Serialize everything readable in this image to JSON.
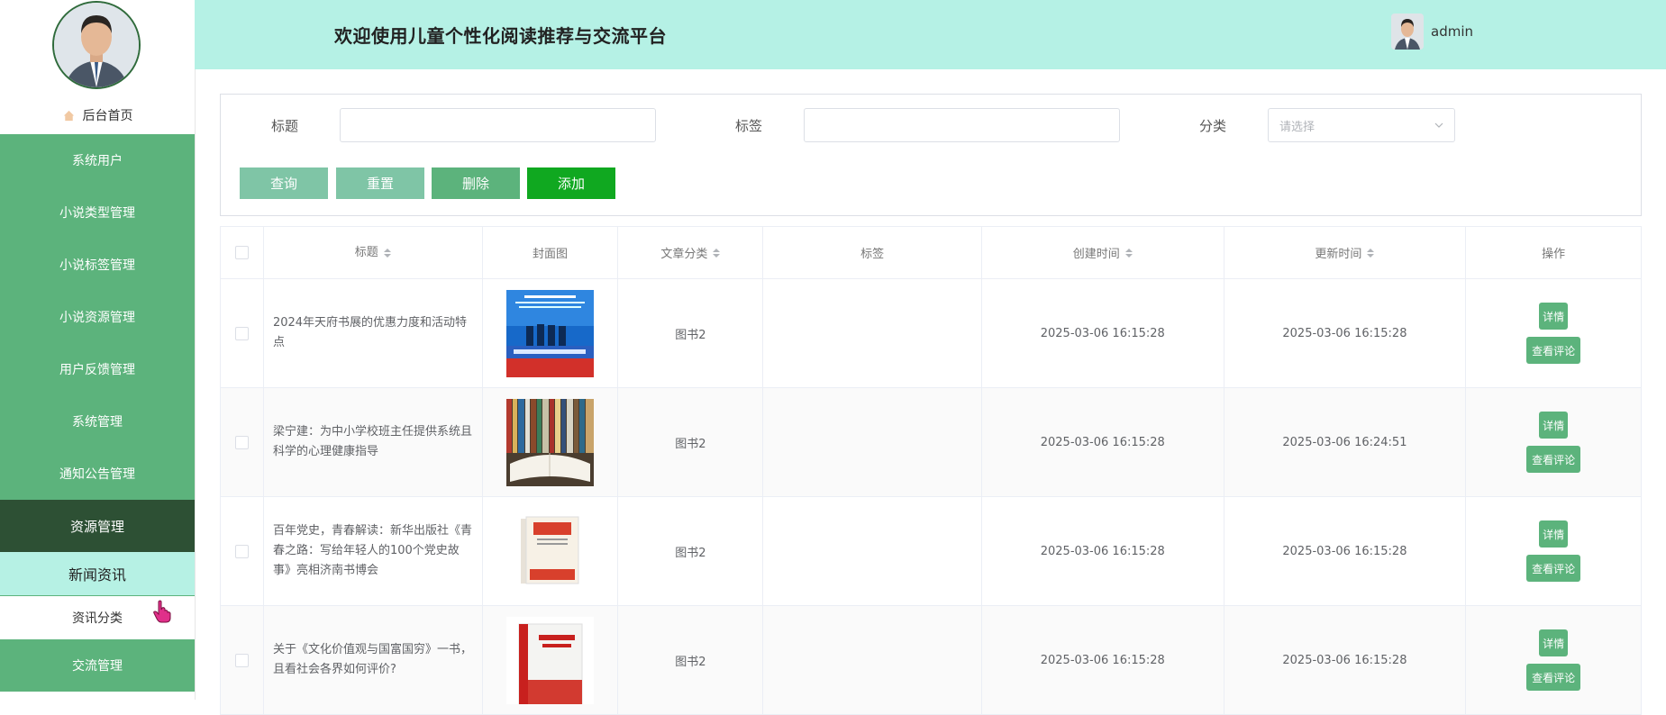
{
  "header": {
    "title": "欢迎使用儿童个性化阅读推荐与交流平台",
    "username": "admin"
  },
  "sidebar": {
    "home_label": "后台首页",
    "items": [
      {
        "label": "系统用户"
      },
      {
        "label": "小说类型管理"
      },
      {
        "label": "小说标签管理"
      },
      {
        "label": "小说资源管理"
      },
      {
        "label": "用户反馈管理"
      },
      {
        "label": "系统管理"
      },
      {
        "label": "通知公告管理"
      },
      {
        "label": "资源管理"
      }
    ],
    "sub_items": [
      {
        "label": "新闻资讯"
      },
      {
        "label": "资讯分类"
      }
    ],
    "last_item": {
      "label": "交流管理"
    }
  },
  "search": {
    "title_label": "标题",
    "title_value": "",
    "tag_label": "标签",
    "tag_value": "",
    "category_label": "分类",
    "category_placeholder": "请选择",
    "buttons": {
      "query": "查询",
      "reset": "重置",
      "delete": "删除",
      "add": "添加"
    }
  },
  "table": {
    "columns": [
      "标题",
      "封面图",
      "文章分类",
      "标签",
      "创建时间",
      "更新时间",
      "操作"
    ],
    "rows": [
      {
        "title": "2024年天府书展的优惠力度和活动特点",
        "category": "图书2",
        "tag": "",
        "created": "2025-03-06 16:15:28",
        "updated": "2025-03-06 16:15:28",
        "detail": "详情",
        "comments": "查看评论"
      },
      {
        "title": "梁宁建：为中小学校班主任提供系统且科学的心理健康指导",
        "category": "图书2",
        "tag": "",
        "created": "2025-03-06 16:15:28",
        "updated": "2025-03-06 16:24:51",
        "detail": "详情",
        "comments": "查看评论"
      },
      {
        "title": "百年党史，青春解读：新华出版社《青春之路：写给年轻人的100个党史故事》亮相济南书博会",
        "category": "图书2",
        "tag": "",
        "created": "2025-03-06 16:15:28",
        "updated": "2025-03-06 16:15:28",
        "detail": "详情",
        "comments": "查看评论"
      },
      {
        "title": "关于《文化价值观与国富国穷》一书，且看社会各界如何评价?",
        "category": "图书2",
        "tag": "",
        "created": "2025-03-06 16:15:28",
        "updated": "2025-03-06 16:15:28",
        "detail": "详情",
        "comments": "查看评论"
      }
    ]
  },
  "colors": {
    "header_bg": "#b5f1e5",
    "menu_green": "#5cb37c",
    "menu_active": "#2d5034",
    "btn_query": "#7fc5a6",
    "btn_delete": "#5cb37c",
    "btn_add": "#10a820"
  }
}
